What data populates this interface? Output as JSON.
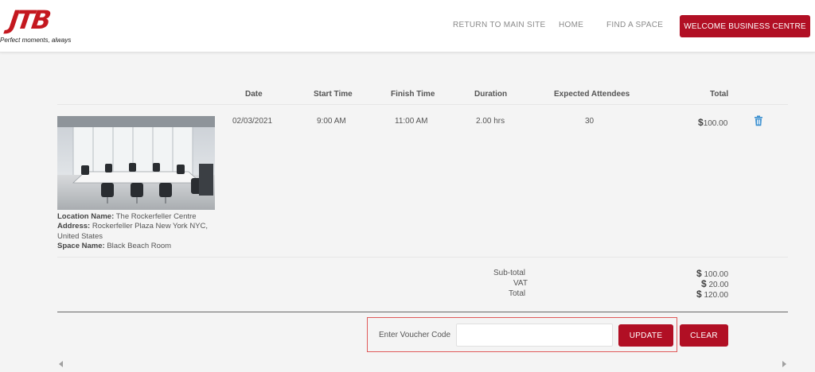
{
  "header": {
    "logo_text": "JTB",
    "tagline": "Perfect moments, always",
    "nav": {
      "return_label": "RETURN TO MAIN SITE",
      "home_label": "HOME",
      "find_label": "FIND A SPACE",
      "welcome_label": "WELCOME BUSINESS CENTRE"
    }
  },
  "booking_table": {
    "columns": {
      "date": "Date",
      "start_time": "Start Time",
      "finish_time": "Finish Time",
      "duration": "Duration",
      "attendees": "Expected Attendees",
      "total": "Total"
    },
    "row": {
      "date": "02/03/2021",
      "start_time": "9:00 AM",
      "finish_time": "11:00 AM",
      "duration": "2.00 hrs",
      "attendees": "30",
      "total_currency": "$",
      "total_amount": "100.00",
      "delete_icon": "trash-icon",
      "location": {
        "location_name_label": "Location Name:",
        "location_name": "The Rockerfeller Centre",
        "address_label": "Address:",
        "address": "Rockerfeller Plaza New York NYC, United States",
        "space_name_label": "Space Name:",
        "space_name": "Black Beach Room"
      }
    }
  },
  "summary": {
    "subtotal_label": "Sub-total",
    "subtotal_currency": "$",
    "subtotal_amount": "100.00",
    "vat_label": "VAT",
    "vat_currency": "$",
    "vat_amount": "20.00",
    "total_label": "Total",
    "total_currency": "$",
    "total_amount": "120.00"
  },
  "voucher": {
    "label": "Enter Voucher Code",
    "value": "",
    "update_label": "UPDATE",
    "clear_label": "CLEAR"
  },
  "colors": {
    "brand_red": "#b10f24",
    "logo_red": "#c4181f",
    "highlight_border": "#e05a5a",
    "trash_blue": "#3a8fd0",
    "page_bg": "#f4f4f4"
  }
}
